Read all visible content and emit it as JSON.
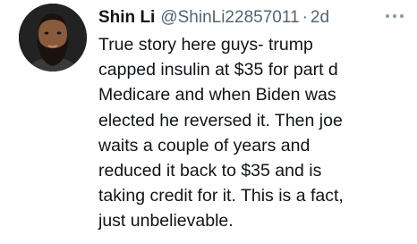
{
  "tweet": {
    "author": {
      "display_name": "Shin Li",
      "handle": "@ShinLi22857011",
      "separator": "·",
      "time": "2d",
      "avatar_icon": "user-avatar-photo"
    },
    "more_icon": "more-options-icon",
    "text_lines": [
      "True story here guys- trump",
      "capped insulin at $35 for part d",
      "Medicare and when Biden was",
      "elected he reversed it. Then joe",
      "waits a couple of years and",
      "reduced it back to $35 and is",
      "taking credit for it. This is a fact,",
      "just unbelievable."
    ]
  },
  "colors": {
    "primary_text": "#0f1419",
    "secondary_text": "#536471",
    "background": "#ffffff"
  }
}
